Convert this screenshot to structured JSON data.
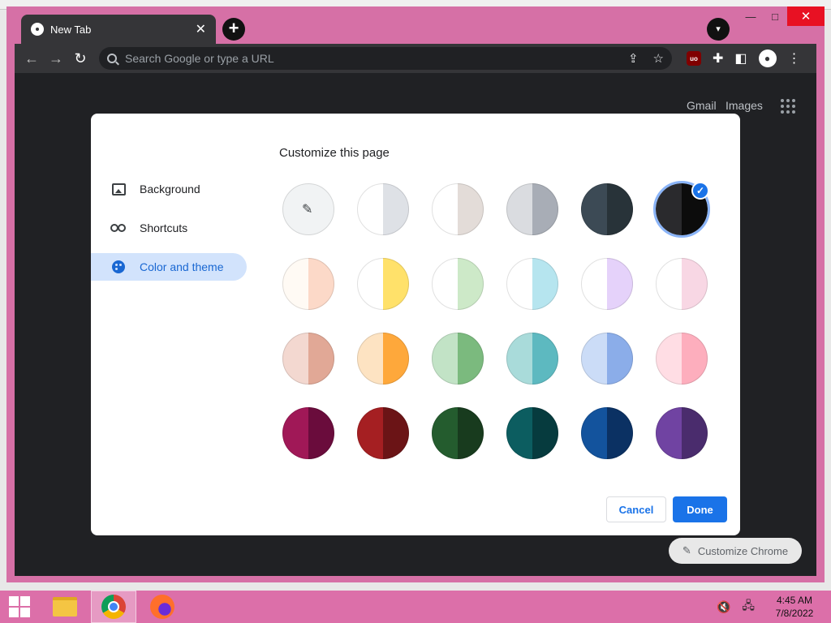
{
  "window": {
    "tab_title": "New Tab",
    "tab_close_glyph": "✕",
    "new_tab_glyph": "+",
    "tab_search_glyph": "▾",
    "controls": {
      "minimize": "—",
      "maximize": "□",
      "close": "✕"
    }
  },
  "toolbar": {
    "back_glyph": "←",
    "forward_glyph": "→",
    "reload_glyph": "↻",
    "omnibox_placeholder": "Search Google or type a URL",
    "share_glyph": "⇪",
    "bookmark_glyph": "☆",
    "ublock_label": "uo",
    "extensions_glyph": "✚",
    "sidepanel_glyph": "◧",
    "profile_glyph": "●",
    "menu_glyph": "⋮"
  },
  "ntp": {
    "gmail": "Gmail",
    "images": "Images",
    "customize_chrome": "Customize Chrome",
    "customize_icon": "✎"
  },
  "dialog": {
    "title": "Customize this page",
    "nav": [
      {
        "label": "Background",
        "icon": "image-icon"
      },
      {
        "label": "Shortcuts",
        "icon": "link-icon"
      },
      {
        "label": "Color and theme",
        "icon": "palette-icon",
        "active": true
      }
    ],
    "picker_glyph": "✎",
    "check_glyph": "✓",
    "swatches": [
      {
        "name": "custom-color",
        "left": "#f1f3f4",
        "right": "#f1f3f4",
        "custom": true
      },
      {
        "name": "default",
        "left": "#ffffff",
        "right": "#dee1e6"
      },
      {
        "name": "warm-grey",
        "left": "#ffffff",
        "right": "#e3dcd8"
      },
      {
        "name": "cool-grey",
        "left": "#dadce0",
        "right": "#a8adb6"
      },
      {
        "name": "midnight-blue",
        "left": "#3c4a55",
        "right": "#283339"
      },
      {
        "name": "black",
        "left": "#2a2a2d",
        "right": "#0c0c0c",
        "selected": true
      },
      {
        "name": "beige-white",
        "left": "#fffaf4",
        "right": "#fcd9c8"
      },
      {
        "name": "yellow-white",
        "left": "#ffffff",
        "right": "#ffe16a"
      },
      {
        "name": "green-white",
        "left": "#ffffff",
        "right": "#cde9c8"
      },
      {
        "name": "light-teal-white",
        "left": "#ffffff",
        "right": "#b6e5ef"
      },
      {
        "name": "light-purple-white",
        "left": "#ffffff",
        "right": "#e5d2fa"
      },
      {
        "name": "pink-white",
        "left": "#ffffff",
        "right": "#f8d7e4"
      },
      {
        "name": "salmon",
        "left": "#f3d8d0",
        "right": "#e1a896"
      },
      {
        "name": "orange",
        "left": "#fde3c2",
        "right": "#fea83b"
      },
      {
        "name": "green",
        "left": "#c2e3c6",
        "right": "#7bba7e"
      },
      {
        "name": "light-teal",
        "left": "#a9dbda",
        "right": "#5db9c0"
      },
      {
        "name": "light-blue",
        "left": "#cbdcf7",
        "right": "#8bade9"
      },
      {
        "name": "light-pink",
        "left": "#ffdde4",
        "right": "#fdaebd"
      },
      {
        "name": "dark-pink",
        "left": "#a01857",
        "right": "#6a0c3c"
      },
      {
        "name": "dark-red",
        "left": "#a51f22",
        "right": "#6b1416"
      },
      {
        "name": "dark-green",
        "left": "#245c2e",
        "right": "#183b1e"
      },
      {
        "name": "dark-teal",
        "left": "#0c5d60",
        "right": "#063b3e"
      },
      {
        "name": "dark-blue",
        "left": "#13539d",
        "right": "#0b3163"
      },
      {
        "name": "purple",
        "left": "#7043a2",
        "right": "#4a2c6d"
      }
    ],
    "cancel": "Cancel",
    "done": "Done"
  },
  "taskbar": {
    "apps": [
      {
        "name": "file-explorer",
        "active": false
      },
      {
        "name": "chrome",
        "active": true
      },
      {
        "name": "firefox",
        "active": false
      }
    ],
    "tray": {
      "volume_glyph": "🔇",
      "network_glyph": "🖧"
    },
    "time": "4:45 AM",
    "date": "7/8/2022"
  }
}
